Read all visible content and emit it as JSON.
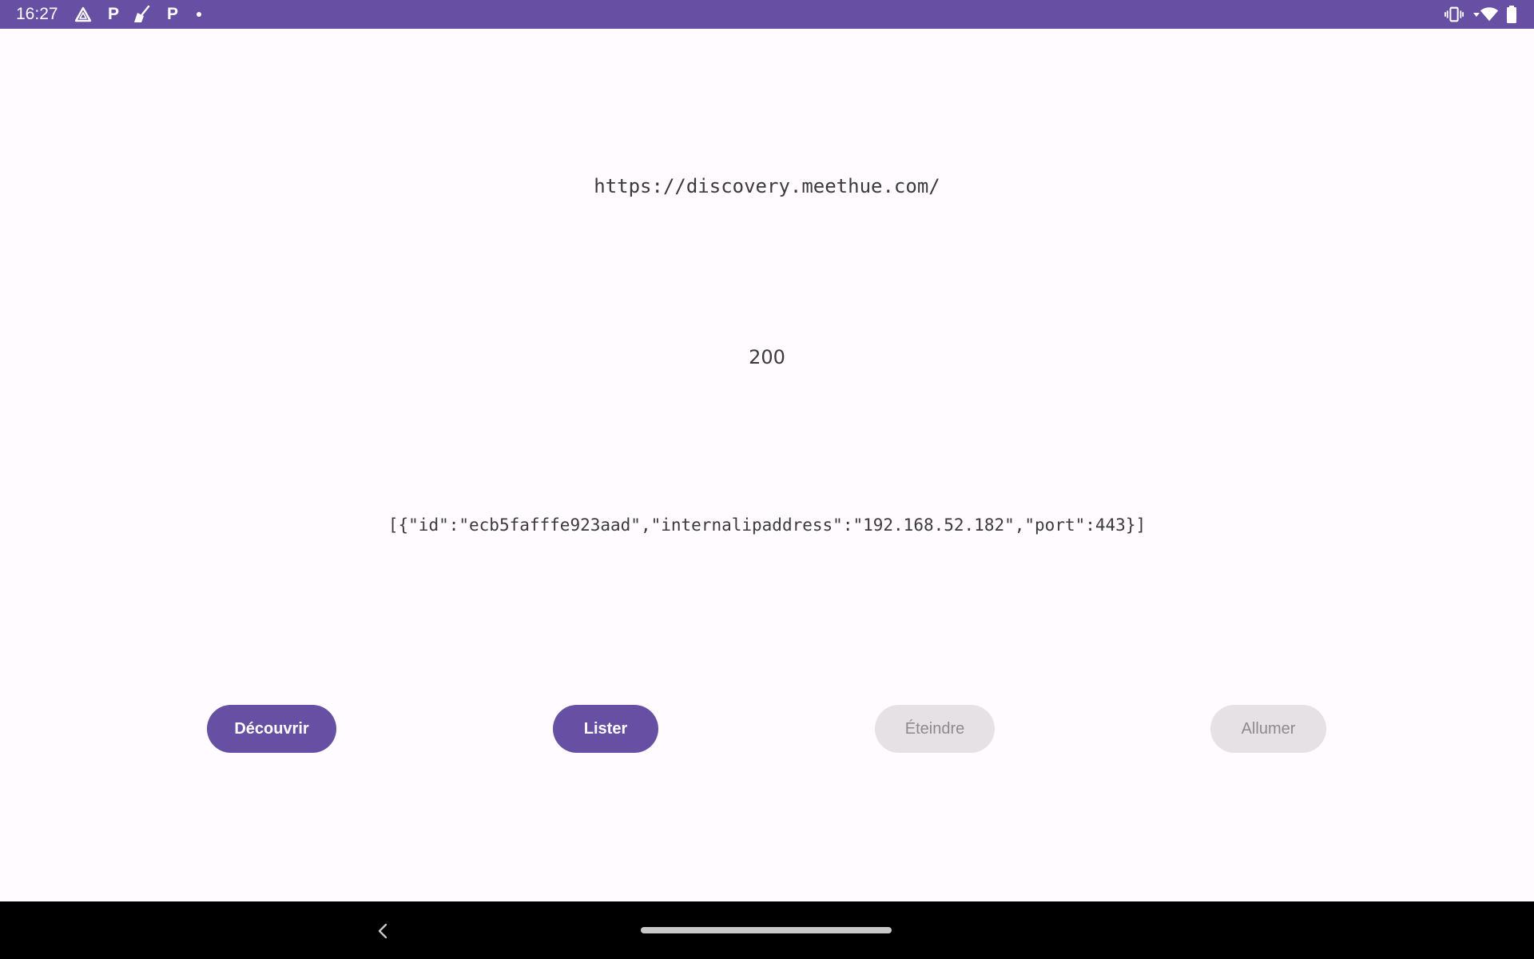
{
  "status_bar": {
    "time": "16:27",
    "notification_icons": [
      "drive-triangle-icon",
      "parking-p-icon",
      "broom-icon",
      "parking-p-icon",
      "dot-icon"
    ],
    "system_icons": [
      "vibrate-icon",
      "wifi-icon",
      "battery-icon"
    ],
    "letters": {
      "p1": "P",
      "p2": "P"
    },
    "bg_color": "#6750a4"
  },
  "main": {
    "url": "https://discovery.meethue.com/",
    "status_code": "200",
    "response": "[{\"id\":\"ecb5fafffe923aad\",\"internalipaddress\":\"192.168.52.182\",\"port\":443}]"
  },
  "buttons": {
    "discover": "Découvrir",
    "list": "Lister",
    "turn_off": "Éteindre",
    "turn_on": "Allumer"
  },
  "colors": {
    "primary": "#6750a4",
    "disabled_bg": "#e6e1e5",
    "disabled_text": "#8d8a8e",
    "background": "#fffbfe"
  },
  "nav_bar": {
    "icons": [
      "back-icon",
      "home-handle"
    ]
  }
}
